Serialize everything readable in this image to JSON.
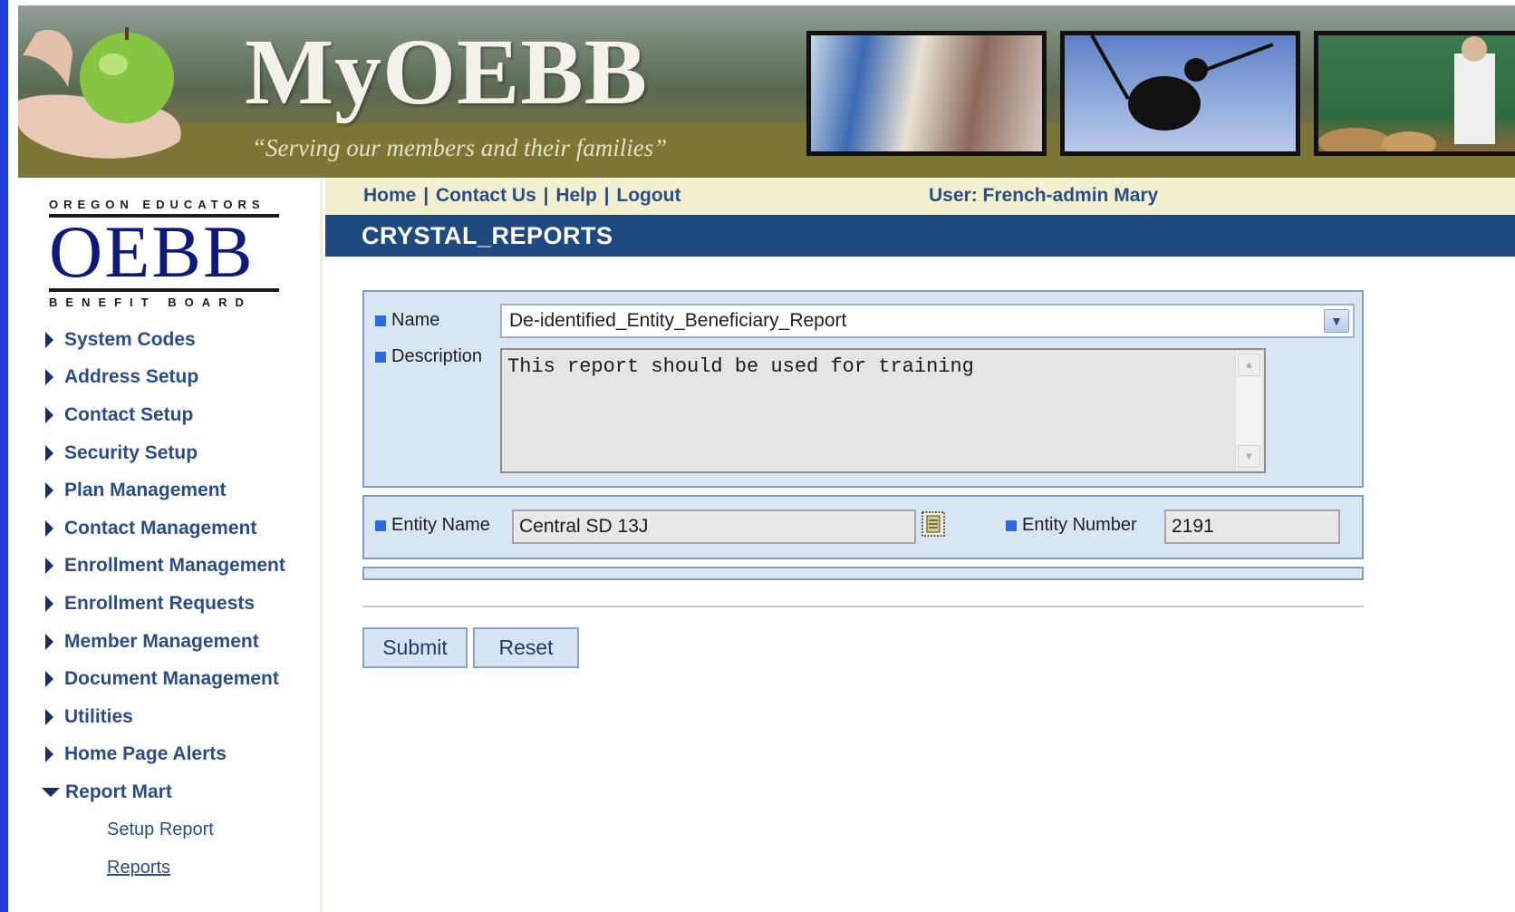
{
  "banner": {
    "title": "MyOEBB",
    "tagline": "“Serving our members and their families”"
  },
  "logo": {
    "top_text": "OREGON EDUCATORS",
    "big_text": "OEBB",
    "bottom_text": "BENEFIT BOARD"
  },
  "topnav": {
    "links": [
      "Home",
      "Contact Us",
      "Help",
      "Logout"
    ],
    "user_label": "User: French-admin Mary"
  },
  "page": {
    "title": "CRYSTAL_REPORTS"
  },
  "sidebar": {
    "items": [
      {
        "label": "System Codes"
      },
      {
        "label": "Address Setup"
      },
      {
        "label": "Contact Setup"
      },
      {
        "label": "Security Setup"
      },
      {
        "label": "Plan Management"
      },
      {
        "label": "Contact Management"
      },
      {
        "label": "Enrollment Management"
      },
      {
        "label": "Enrollment Requests"
      },
      {
        "label": "Member Management"
      },
      {
        "label": "Document Management"
      },
      {
        "label": "Utilities"
      },
      {
        "label": "Home Page Alerts"
      },
      {
        "label": "Report Mart"
      }
    ],
    "sub_items": [
      {
        "label": "Setup Report"
      },
      {
        "label": "Reports"
      }
    ]
  },
  "form": {
    "name_label": "Name",
    "name_value": "De-identified_Entity_Beneficiary_Report",
    "description_label": "Description",
    "description_value": "This report should be used for training",
    "entity_name_label": "Entity Name",
    "entity_name_value": "Central SD 13J",
    "entity_number_label": "Entity Number",
    "entity_number_value": "2191"
  },
  "buttons": {
    "submit": "Submit",
    "reset": "Reset"
  },
  "colors": {
    "left_rail": "#1f3fd8",
    "title_bar": "#1f4a7f",
    "topbar": "#f3f0cf",
    "link": "#2b4d86",
    "panel": "#d8e6f3"
  }
}
